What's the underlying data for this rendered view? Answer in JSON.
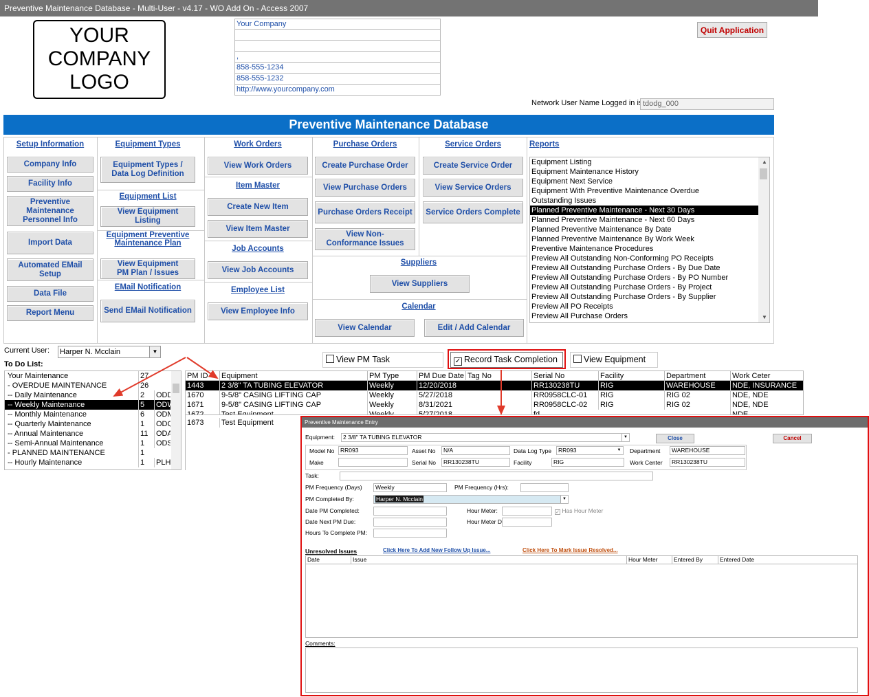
{
  "window": {
    "title": "Preventive Maintenance Database - Multi-User - v4.17 - WO Add On - Access 2007"
  },
  "logo": {
    "line1": "YOUR",
    "line2": "COMPANY",
    "line3": "LOGO"
  },
  "company": {
    "name": "Your Company",
    "line2": "",
    "line3": "",
    "line4": ",",
    "phone": "858-555-1234",
    "fax": "858-555-1232",
    "web": "http://www.yourcompany.com"
  },
  "quit_label": "Quit Application",
  "network": {
    "label": "Network User Name Logged in is",
    "value": "tdodg_000"
  },
  "banner": "Preventive Maintenance Database",
  "menu": {
    "setup": {
      "header": "Setup Information",
      "buttons": [
        "Company Info",
        "Facility Info",
        "Preventive Maintenance Personnel Info",
        "Import Data",
        "Automated EMail Setup",
        "Data File",
        "Report Menu"
      ]
    },
    "equip_types": {
      "header": "Equipment Types",
      "button": "Equipment Types / Data Log Definition"
    },
    "equip_list": {
      "header": "Equipment List",
      "button": "View Equipment Listing"
    },
    "equip_pm": {
      "header": "Equipment Preventive Maintenance Plan",
      "button": "View Equipment PM Plan / Issues"
    },
    "email": {
      "header": "EMail Notification",
      "button": "Send EMail Notification"
    },
    "work_orders": {
      "header": "Work Orders",
      "button": "View Work Orders"
    },
    "item_master": {
      "header": "Item Master",
      "button1": "Create New Item",
      "button2": "View Item Master"
    },
    "job_accounts": {
      "header": "Job Accounts",
      "button": "View Job Accounts"
    },
    "employee": {
      "header": "Employee List",
      "button": "View Employee Info"
    },
    "purchase": {
      "header": "Purchase Orders",
      "buttons": [
        "Create Purchase Order",
        "View Purchase Orders",
        "Purchase Orders Receipt",
        "View Non-Conformance Issues"
      ]
    },
    "service": {
      "header": "Service Orders",
      "buttons": [
        "Create Service Order",
        "View Service Orders",
        "Service Orders Complete"
      ]
    },
    "suppliers": {
      "header": "Suppliers",
      "button": "View Suppliers"
    },
    "calendar": {
      "header": "Calendar",
      "button1": "View Calendar",
      "button2": "Edit / Add Calendar"
    },
    "reports": {
      "header": "Reports",
      "items": [
        "Equipment Listing",
        "Equipment Maintenance History",
        "Equipment Next Service",
        "Equipment With Preventive Maintenance Overdue",
        "Outstanding Issues",
        "Planned Preventive Maintenance - Next 30 Days",
        "Planned Preventive Maintenance - Next 60 Days",
        "Planned Preventive Maintenance By Date",
        "Planned Preventive Maintenance By Work Week",
        "Preventive Maintenance Procedures",
        "Preview All Outstanding Non-Conforming PO Receipts",
        "Preview All Outstanding Purchase Orders - By Due Date",
        "Preview All Outstanding Purchase Orders - By PO Number",
        "Preview All Outstanding Purchase Orders - By Project",
        "Preview All Outstanding Purchase Orders - By Supplier",
        "Preview All PO Receipts",
        "Preview All Purchase Orders"
      ],
      "selected_index": 5
    }
  },
  "current_user": {
    "label": "Current User:",
    "value": "Harper N. Mcclain"
  },
  "todo": {
    "label": "To Do List:",
    "rows": [
      {
        "name": "Your Maintenance",
        "count": "27",
        "code": ""
      },
      {
        "name": " - OVERDUE MAINTENANCE",
        "count": "26",
        "code": ""
      },
      {
        "name": " -- Daily Maintenance",
        "count": "2",
        "code": "ODD"
      },
      {
        "name": " -- Weekly Maintenance",
        "count": "5",
        "code": "ODW"
      },
      {
        "name": " -- Monthly Maintenance",
        "count": "6",
        "code": "ODM"
      },
      {
        "name": " -- Quarterly Maintenance",
        "count": "1",
        "code": "ODQ"
      },
      {
        "name": " -- Annual Maintenance",
        "count": "11",
        "code": "ODA"
      },
      {
        "name": " -- Semi-Annual Maintenance",
        "count": "1",
        "code": "ODS"
      },
      {
        "name": " - PLANNED MAINTENANCE",
        "count": "1",
        "code": ""
      },
      {
        "name": " -- Hourly Maintenance",
        "count": "1",
        "code": "PLH"
      }
    ],
    "selected_index": 3
  },
  "toggles": {
    "view_pm": "View PM Task",
    "record": "Record Task Completion",
    "view_equip": "View Equipment"
  },
  "pm_grid": {
    "headers": [
      "PM ID",
      "Equipment",
      "PM Type",
      "PM Due Date",
      "Tag No",
      "Serial No",
      "Facility",
      "Department",
      "Work Ceter"
    ],
    "rows": [
      [
        "1443",
        "2 3/8\" TA TUBING ELEVATOR",
        "Weekly",
        "12/20/2018",
        "",
        "RR130238TU",
        "RIG",
        "WAREHOUSE",
        "NDE, INSURANCE"
      ],
      [
        "1670",
        "9-5/8\" CASING LIFTING CAP",
        "Weekly",
        "5/27/2018",
        "",
        "RR0958CLC-01",
        "RIG",
        "RIG 02",
        "NDE, NDE"
      ],
      [
        "1671",
        "9-5/8\" CASING LIFTING CAP",
        "Weekly",
        "8/31/2021",
        "",
        "RR0958CLC-02",
        "RIG",
        "RIG 02",
        "NDE, NDE"
      ],
      [
        "1672",
        "Test Equipment",
        "Weekly",
        "5/27/2018",
        "",
        "fd",
        "",
        "",
        "NDE"
      ],
      [
        "1673",
        "Test Equipment",
        "",
        "",
        "",
        "",
        "",
        "",
        ""
      ]
    ],
    "selected_index": 0
  },
  "dialog": {
    "title": "Preventive Maintenance Entry",
    "equipment_label": "Equipment:",
    "equipment": "2 3/8\" TA TUBING ELEVATOR",
    "close": "Close",
    "cancel": "Cancel",
    "model_no_label": "Model No",
    "model_no": "RR093",
    "asset_no_label": "Asset No",
    "asset_no": "N/A",
    "data_log_label": "Data Log Type",
    "data_log": "RR093",
    "department_label": "Department",
    "department": "WAREHOUSE",
    "make_label": "Make",
    "make": "",
    "serial_label": "Serial No",
    "serial": "RR130238TU",
    "facility_label": "Facility",
    "facility": "RIG",
    "work_center_label": "Work Center",
    "work_center": "RR130238TU",
    "task_label": "Task:",
    "task": "",
    "pm_freq_days_label": "PM Frequency (Days)",
    "pm_freq_days": "Weekly",
    "pm_freq_hrs_label": "PM Frequency (Hrs):",
    "pm_freq_hrs": "",
    "completed_by_label": "PM Completed By:",
    "completed_by": "Harper N. Mcclain",
    "date_completed_label": "Date PM Completed:",
    "hour_meter_label": "Hour Meter:",
    "has_hour_meter": "Has Hour Meter",
    "date_next_label": "Date Next PM Due:",
    "hour_meter_due_label": "Hour Meter Due:",
    "hours_label": "Hours To Complete PM:",
    "unresolved_label": "Unresolved Issues",
    "add_issue_link": "Click Here To Add New Follow Up Issue...",
    "resolve_link": "Click Here To Mark Issue Resolved...",
    "issue_headers": [
      "Date",
      "Issue",
      "Hour Meter",
      "Entered By",
      "Entered Date"
    ],
    "comments_label": "Comments:"
  },
  "colors": {
    "banner": "#0b6fc7",
    "link": "#1f4fa8",
    "highlight": "#e01010"
  }
}
